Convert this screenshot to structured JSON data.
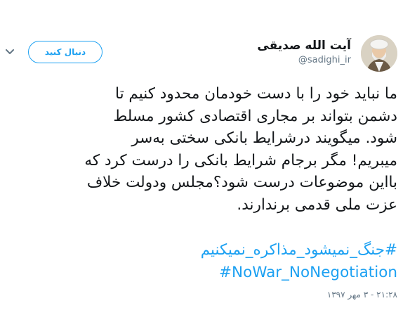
{
  "profile": {
    "display_name": "آیت الله صدیقی",
    "handle": "@sadighi_ir",
    "avatar": "avatar-portrait"
  },
  "actions": {
    "follow_label": "دنبال کنید",
    "menu_icon": "chevron-down-icon"
  },
  "tweet": {
    "lines": [
      "ما نباید خود را با دست خودمان محدود کنیم تا",
      "دشمن بتواند بر مجاری اقتصادی کشور مسلط",
      "شود. میگویند درشرایط بانکی سختی به‌سر",
      "میبریم! مگر برجام شرایط بانکی را درست کرد که",
      "بااین موضوعات درست شود؟مجلس ودولت خلاف",
      "عزت ملی قدمی برندارند."
    ],
    "hashtags": [
      "#جنگ_نمیشود_مذاکره_نمیکنیم",
      "#NoWar_NoNegotiation"
    ],
    "timestamp": "۲۱:۲۸ - ۳ مهر ۱۳۹۷"
  },
  "colors": {
    "accent": "#1da1f2",
    "text": "#14171a",
    "muted": "#657786"
  }
}
